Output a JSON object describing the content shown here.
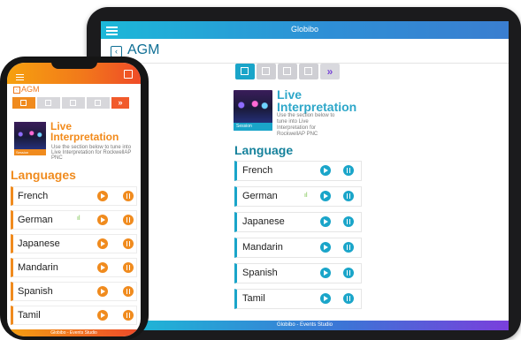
{
  "tablet": {
    "app_title": "Globibo",
    "page_title": "AGM",
    "live_title": "Live\nInterpretation",
    "description": "Use the section below to tune into Live Interpretation for RockwellAP PNC",
    "cover_tag": "Session",
    "section_title": "Language",
    "languages": [
      "French",
      "German",
      "Japanese",
      "Mandarin",
      "Spanish",
      "Tamil"
    ],
    "footer": "Globibo - Events Studio",
    "toolbar_more": "»"
  },
  "phone": {
    "page_title": "AGM",
    "live_title": "Live\nInterpretation",
    "description": "Use the section below to tune into Live Interpretation for RockwellAP PNC",
    "cover_tag": "Session",
    "section_title": "Languages",
    "languages": [
      "French",
      "German",
      "Japanese",
      "Mandarin",
      "Spanish",
      "Tamil"
    ],
    "footer": "Globibo - Events Studio",
    "toolbar_more": "»"
  }
}
